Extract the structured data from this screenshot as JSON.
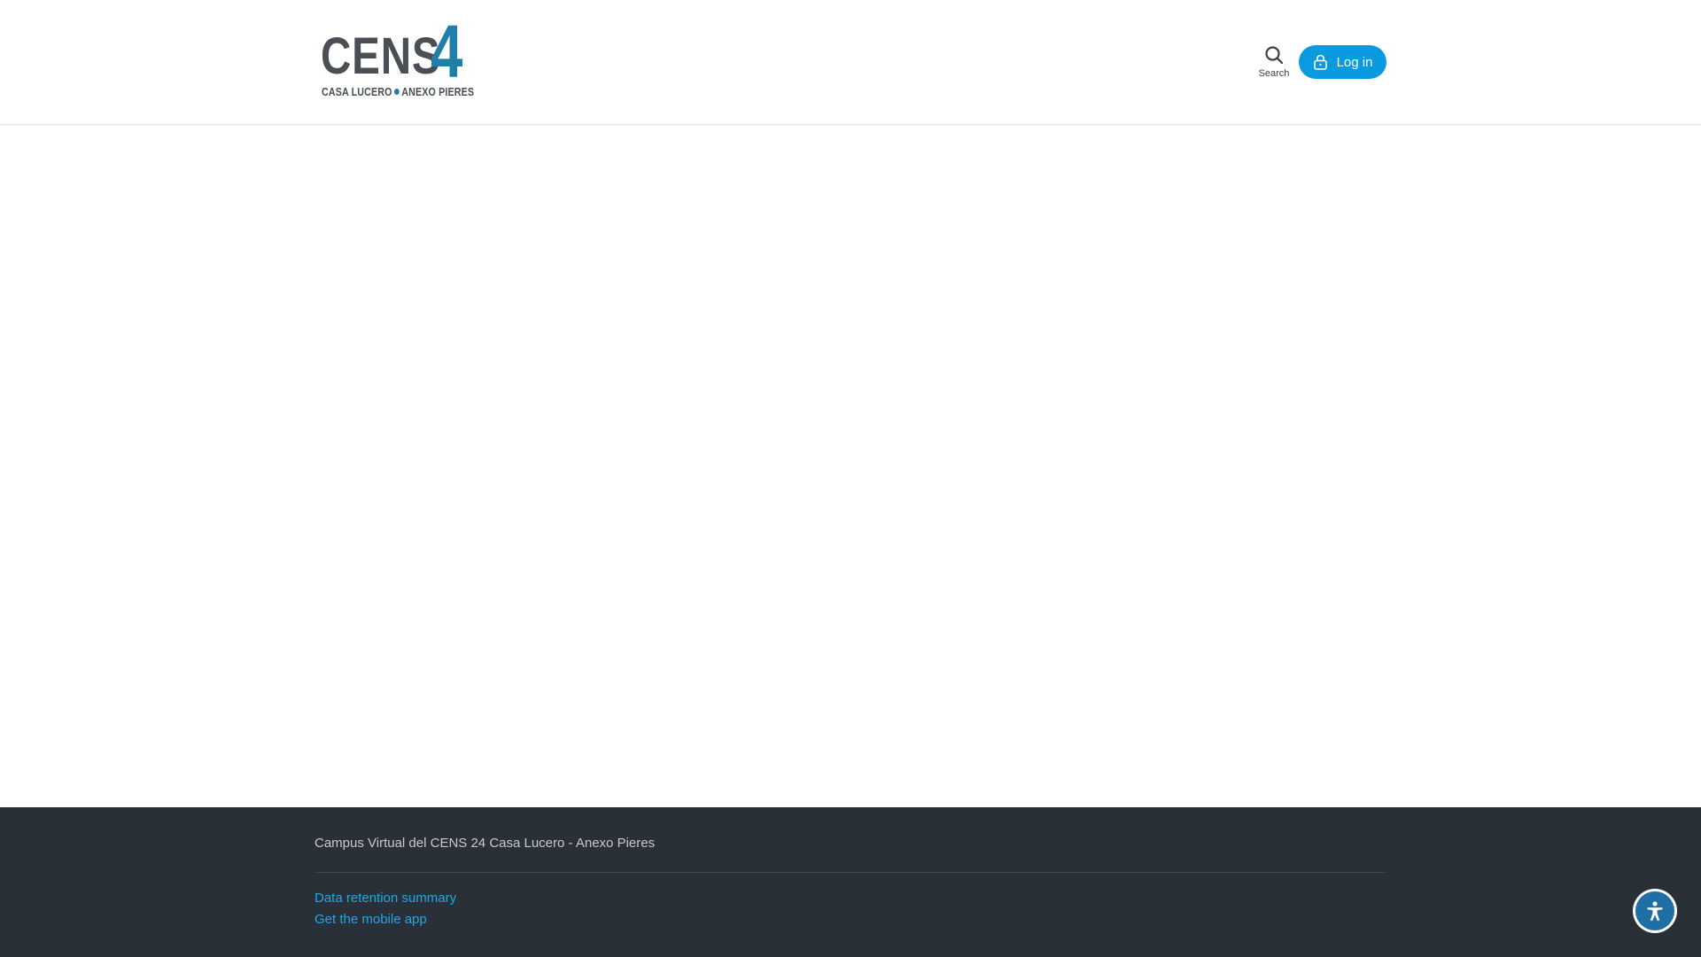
{
  "header": {
    "logo": {
      "main_text": "CENS",
      "number": "4",
      "sub_left": "CASA LUCERO",
      "sub_right": "ANEXO PIERES"
    },
    "search_label": "Search",
    "login_label": "Log in",
    "colors": {
      "accent": "#0a9ae0",
      "logo_blue": "#1f7fa8",
      "logo_gray": "#4a4f55"
    }
  },
  "footer": {
    "site_name": "Campus Virtual del CENS 24 Casa Lucero - Anexo Pieres",
    "links": [
      {
        "label": "Data retention summary"
      },
      {
        "label": "Get the mobile app"
      }
    ],
    "colors": {
      "background": "#2a3038",
      "link": "#1ea8e8"
    }
  },
  "icons": {
    "search": "search-icon",
    "login": "lock-icon",
    "accessibility": "accessibility-icon"
  }
}
